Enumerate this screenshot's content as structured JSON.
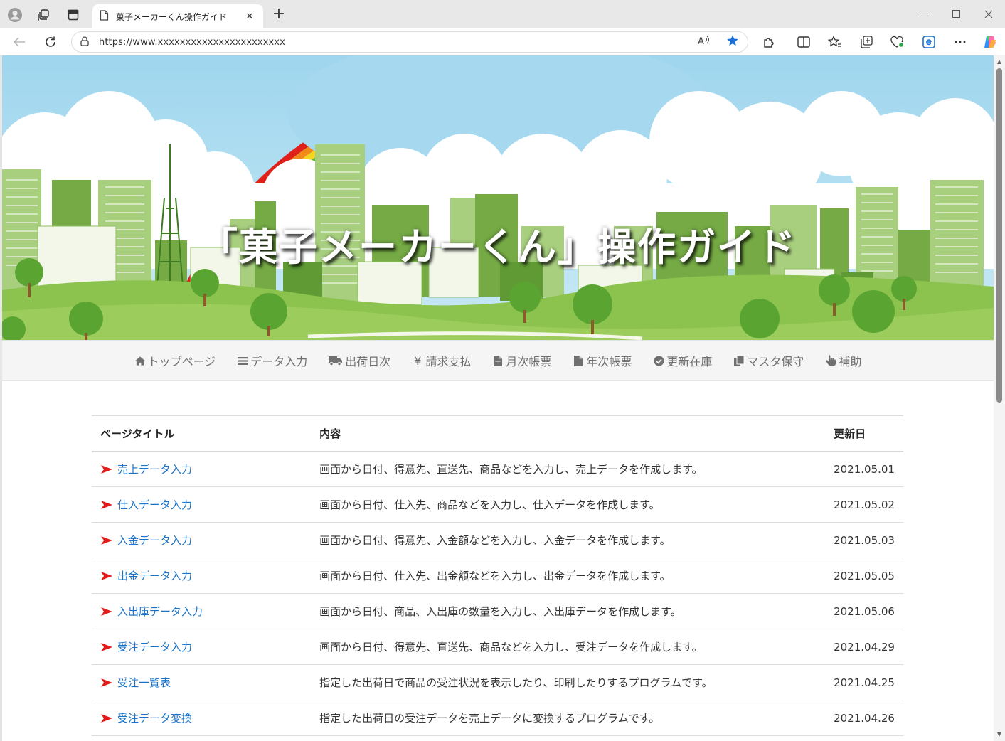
{
  "browser": {
    "tab_title": "菓子メーカーくん操作ガイド",
    "url": "https://www.xxxxxxxxxxxxxxxxxxxxxxx"
  },
  "hero": {
    "title": "「菓子メーカーくん」操作ガイド"
  },
  "menu": [
    {
      "label": "トップページ",
      "icon": "home-icon"
    },
    {
      "label": "データ入力",
      "icon": "list-icon"
    },
    {
      "label": "出荷日次",
      "icon": "truck-icon"
    },
    {
      "label": "請求支払",
      "icon": "yen-icon"
    },
    {
      "label": "月次帳票",
      "icon": "file-icon"
    },
    {
      "label": "年次帳票",
      "icon": "file-icon"
    },
    {
      "label": "更新在庫",
      "icon": "check-circle-icon"
    },
    {
      "label": "マスタ保守",
      "icon": "copy-icon"
    },
    {
      "label": "補助",
      "icon": "hand-pointer-icon"
    }
  ],
  "table": {
    "headers": {
      "title": "ページタイトル",
      "content": "内容",
      "date": "更新日"
    },
    "rows": [
      {
        "title": "売上データ入力",
        "content": "画面から日付、得意先、直送先、商品などを入力し、売上データを作成します。",
        "date": "2021.05.01"
      },
      {
        "title": "仕入データ入力",
        "content": "画面から日付、仕入先、商品などを入力し、仕入データを作成します。",
        "date": "2021.05.02"
      },
      {
        "title": "入金データ入力",
        "content": "画面から日付、得意先、入金額などを入力し、入金データを作成します。",
        "date": "2021.05.03"
      },
      {
        "title": "出金データ入力",
        "content": "画面から日付、仕入先、出金額などを入力し、出金データを作成します。",
        "date": "2021.05.05"
      },
      {
        "title": "入出庫データ入力",
        "content": "画面から日付、商品、入出庫の数量を入力し、入出庫データを作成します。",
        "date": "2021.05.06"
      },
      {
        "title": "受注データ入力",
        "content": "画面から日付、得意先、直送先、商品などを入力し、受注データを作成します。",
        "date": "2021.04.29"
      },
      {
        "title": "受注一覧表",
        "content": "指定した出荷日で商品の受注状況を表示したり、印刷したりするプログラムです。",
        "date": "2021.04.25"
      },
      {
        "title": "受注データ変換",
        "content": "指定した出荷日の受注データを売上データに変換するプログラムです。",
        "date": "2021.04.26"
      }
    ]
  },
  "colors": {
    "link": "#1a73c8",
    "arrow": "#e31b1b",
    "menu_text": "#707070",
    "accent_star": "#1a6fd6"
  }
}
